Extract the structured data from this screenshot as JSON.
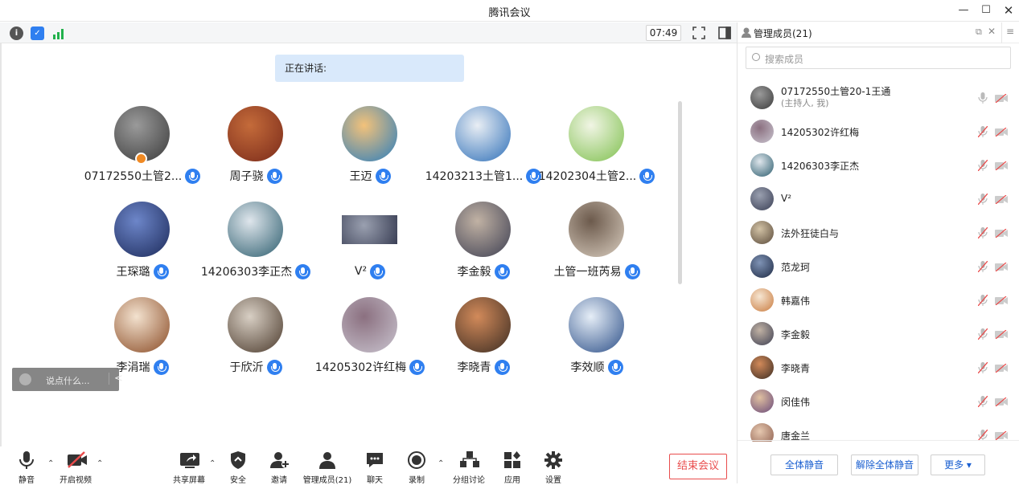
{
  "window": {
    "title": "腾讯会议"
  },
  "status": {
    "time": "07:49"
  },
  "speaking": {
    "label": "正在讲话:"
  },
  "grid": [
    {
      "name": "07172550土管2...",
      "host": true,
      "c1": "#3b3b3b",
      "c2": "#9a9a9a"
    },
    {
      "name": "周子骁",
      "c1": "#7a2a1a",
      "c2": "#c46b3a"
    },
    {
      "name": "王迈",
      "c1": "#2a7dbd",
      "c2": "#f3c27a"
    },
    {
      "name": "14203213土管1...",
      "c1": "#2e6fb8",
      "c2": "#e9eef4"
    },
    {
      "name": "14202304土管2...",
      "c1": "#7fc04e",
      "c2": "#f1f5e5"
    },
    {
      "name": "王琛璐",
      "c1": "#1c2a5a",
      "c2": "#6d86c9"
    },
    {
      "name": "14206303李正杰",
      "c1": "#2c5d6e",
      "c2": "#dfe6ec"
    },
    {
      "name": "V²",
      "c1": "#3a3f55",
      "c2": "#9aa0b0",
      "rect": true
    },
    {
      "name": "李金毅",
      "c1": "#3d3f52",
      "c2": "#c1b2a4"
    },
    {
      "name": "土管一班芮易",
      "c1": "#d9cdbf",
      "c2": "#6c5a4c"
    },
    {
      "name": "李涓瑞",
      "c1": "#8a4b25",
      "c2": "#f3e2cf"
    },
    {
      "name": "于欣沂",
      "c1": "#4b3a2c",
      "c2": "#d8cfc4"
    },
    {
      "name": "14205302许红梅",
      "c1": "#c9c4cf",
      "c2": "#8b7080"
    },
    {
      "name": "李晓青",
      "c1": "#3b2c22",
      "c2": "#d28a5a"
    },
    {
      "name": "李效顺",
      "c1": "#2c4f88",
      "c2": "#e6eef7"
    }
  ],
  "chat": {
    "placeholder": "说点什么..."
  },
  "toolbar": {
    "mute": "静音",
    "video": "开启视频",
    "share": "共享屏幕",
    "security": "安全",
    "invite": "邀请",
    "members": "管理成员(21)",
    "chat": "聊天",
    "record": "录制",
    "breakout": "分组讨论",
    "apps": "应用",
    "settings": "设置",
    "end": "结束会议"
  },
  "panel": {
    "title": "管理成员(21)",
    "search_placeholder": "搜索成员",
    "members": [
      {
        "name": "07172550土管20-1王通",
        "sub": "(主持人, 我)",
        "c1": "#3b3b3b",
        "c2": "#9a9a9a",
        "muted": false
      },
      {
        "name": "14205302许红梅",
        "c1": "#c9c4cf",
        "c2": "#8b7080",
        "muted": true
      },
      {
        "name": "14206303李正杰",
        "c1": "#2c5d6e",
        "c2": "#dfe6ec",
        "muted": true
      },
      {
        "name": "V²",
        "c1": "#3a3f55",
        "c2": "#9aa0b0",
        "muted": true
      },
      {
        "name": "法外狂徒白与",
        "c1": "#5a4a3a",
        "c2": "#d2c2a5",
        "muted": true
      },
      {
        "name": "范龙珂",
        "c1": "#1e2a44",
        "c2": "#7f93b5",
        "muted": true
      },
      {
        "name": "韩嘉伟",
        "c1": "#c97b3f",
        "c2": "#f6e6d2",
        "muted": true
      },
      {
        "name": "李金毅",
        "c1": "#3d3f52",
        "c2": "#c1b2a4",
        "muted": true
      },
      {
        "name": "李晓青",
        "c1": "#3b2c22",
        "c2": "#d28a5a",
        "muted": true
      },
      {
        "name": "闵佳伟",
        "c1": "#6a4a7a",
        "c2": "#e0c0a0",
        "muted": true
      },
      {
        "name": "唐金兰",
        "c1": "#8a5a4a",
        "c2": "#e6c8b0",
        "muted": true
      }
    ],
    "mute_all": "全体静音",
    "unmute_all": "解除全体静音",
    "more": "更多 ▾"
  },
  "colors": {
    "accent": "#2f7ff0",
    "danger": "#e94c4c"
  }
}
